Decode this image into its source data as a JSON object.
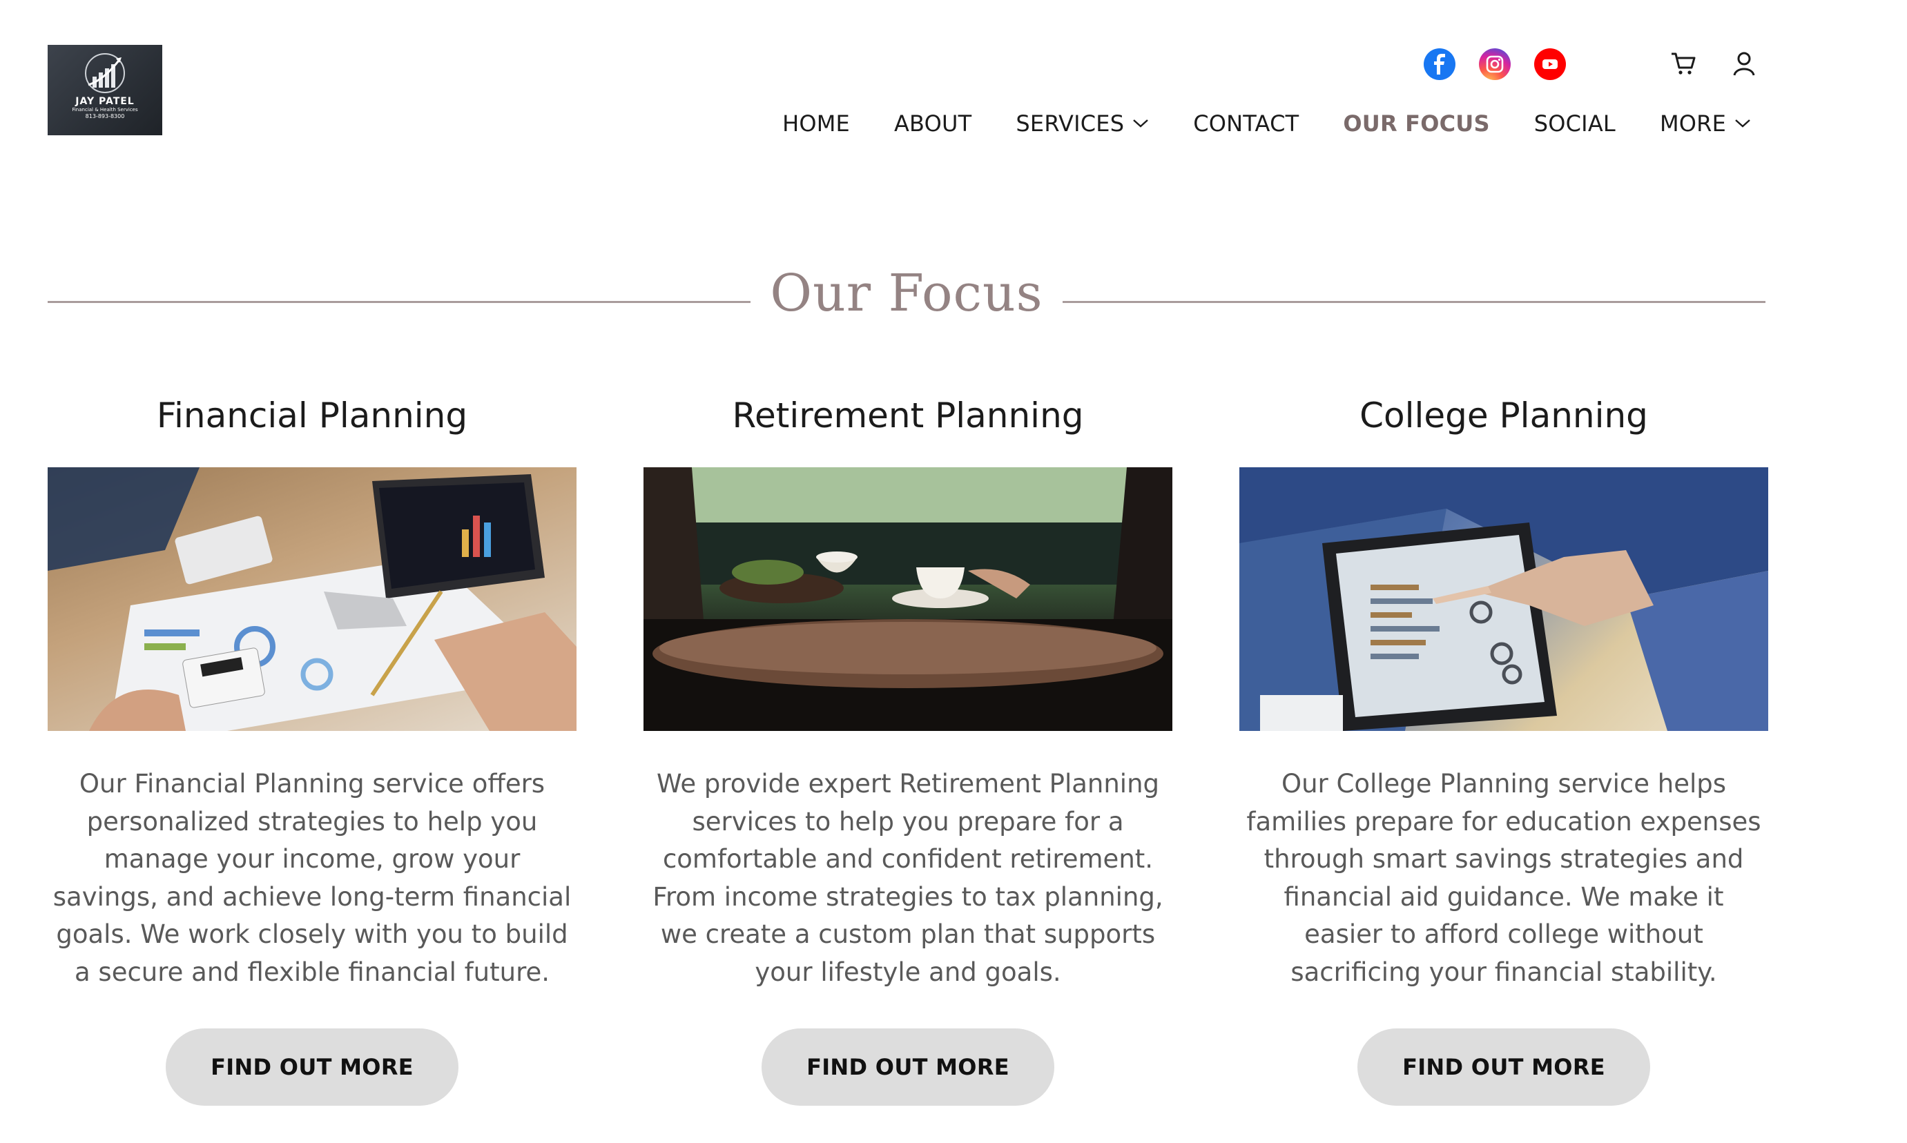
{
  "brand": {
    "logo_name": "JAY PATEL",
    "logo_tagline": "Financial & Health Services",
    "logo_phone": "813-893-8300"
  },
  "social": [
    {
      "name": "facebook-icon",
      "color": "#1877f2"
    },
    {
      "name": "instagram-icon",
      "color": "#d6249f"
    },
    {
      "name": "youtube-icon",
      "color": "#ff0000"
    }
  ],
  "nav": {
    "items": [
      {
        "label": "HOME"
      },
      {
        "label": "ABOUT"
      },
      {
        "label": "SERVICES",
        "dropdown": true
      },
      {
        "label": "CONTACT"
      },
      {
        "label": "OUR FOCUS",
        "active": true
      },
      {
        "label": "SOCIAL"
      },
      {
        "label": "MORE",
        "dropdown": true
      }
    ],
    "active_color": "#7a6a6a"
  },
  "section": {
    "title": "Our Focus",
    "title_color": "#948383"
  },
  "cards": [
    {
      "title": "Financial Planning",
      "image": "financial-planning-photo",
      "body": "Our Financial Planning service offers personalized strategies to help you manage your income, grow your savings, and achieve long-term financial goals. We work closely with you to build a secure and flexible financial future.",
      "button": "FIND OUT MORE"
    },
    {
      "title": "Retirement Planning",
      "image": "retirement-planning-photo",
      "body": "We provide expert Retirement Planning services to help you prepare for a comfortable and confident retirement. From income strategies to tax planning, we create a custom plan that supports your lifestyle and goals.",
      "button": "FIND OUT MORE"
    },
    {
      "title": "College Planning",
      "image": "college-planning-photo",
      "body": "Our College Planning service helps families prepare for education expenses through smart savings strategies and financial aid guidance. We make it easier to afford college without sacrificing your financial stability.",
      "button": "FIND OUT MORE"
    }
  ]
}
